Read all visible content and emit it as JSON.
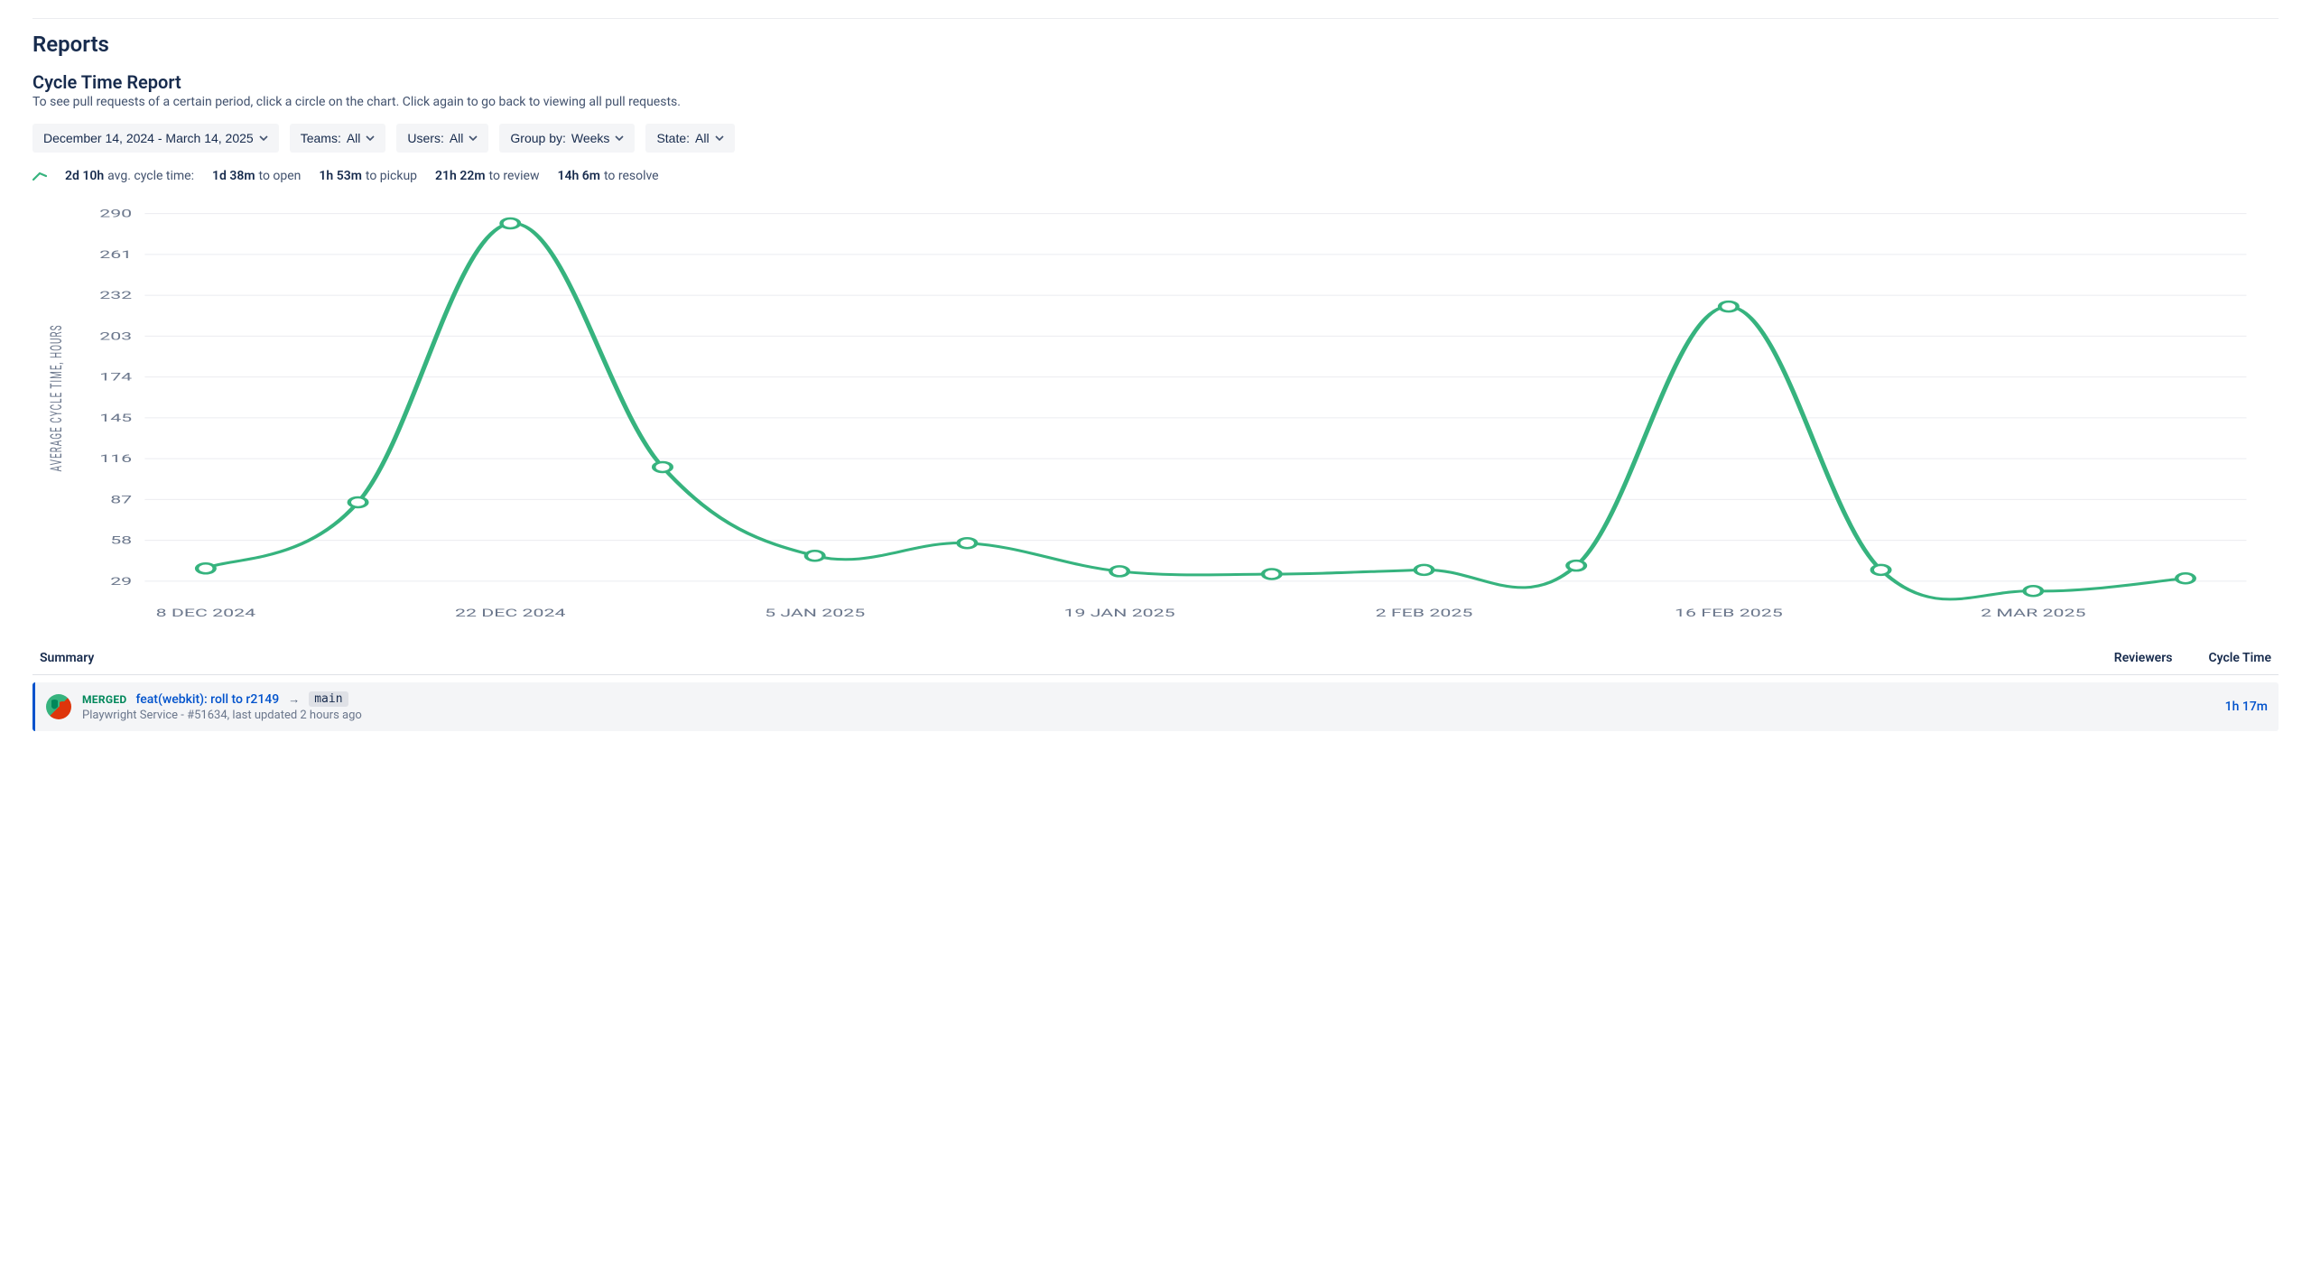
{
  "page_title": "Reports",
  "report_title": "Cycle Time Report",
  "report_subtitle": "To see pull requests of a certain period, click a circle on the chart. Click again to go back to viewing all pull requests.",
  "filters": {
    "date_range": "December 14, 2024 - March 14, 2025",
    "teams_label": "Teams:",
    "teams_value": "All",
    "users_label": "Users:",
    "users_value": "All",
    "group_label": "Group by:",
    "group_value": "Weeks",
    "state_label": "State:",
    "state_value": "All"
  },
  "stats": {
    "avg_value": "2d 10h",
    "avg_label": "avg. cycle time:",
    "open_value": "1d 38m",
    "open_label": "to open",
    "pickup_value": "1h 53m",
    "pickup_label": "to pickup",
    "review_value": "21h 22m",
    "review_label": "to review",
    "resolve_value": "14h 6m",
    "resolve_label": "to resolve"
  },
  "chart_data": {
    "type": "line",
    "title": "",
    "xlabel": "",
    "ylabel": "AVERAGE CYCLE TIME, HOURS",
    "y_ticks": [
      29,
      58,
      87,
      116,
      145,
      174,
      203,
      232,
      261,
      290
    ],
    "x_ticks": [
      "8 DEC 2024",
      "22 DEC 2024",
      "5 JAN 2025",
      "19 JAN 2025",
      "2 FEB 2025",
      "16 FEB 2025",
      "2 MAR 2025"
    ],
    "x_tick_indices": [
      0,
      2,
      4,
      6,
      8,
      10,
      12
    ],
    "series": [
      {
        "name": "Average cycle time (hours)",
        "color": "#36B37E",
        "x": [
          0,
          1,
          2,
          3,
          4,
          5,
          6,
          7,
          8,
          9,
          10,
          11,
          12,
          13
        ],
        "values": [
          38,
          85,
          283,
          110,
          47,
          56,
          36,
          34,
          37,
          40,
          224,
          37,
          22,
          31
        ]
      }
    ],
    "ylim": [
      18,
      300
    ],
    "xlim": [
      -0.4,
      13.4
    ]
  },
  "table": {
    "headers": {
      "summary": "Summary",
      "reviewers": "Reviewers",
      "cycle_time": "Cycle Time"
    },
    "rows": [
      {
        "status": "MERGED",
        "title": "feat(webkit): roll to r2149",
        "target_branch": "main",
        "sub": "Playwright Service - #51634, last updated 2 hours ago",
        "reviewers": "",
        "cycle_time": "1h 17m"
      }
    ]
  }
}
